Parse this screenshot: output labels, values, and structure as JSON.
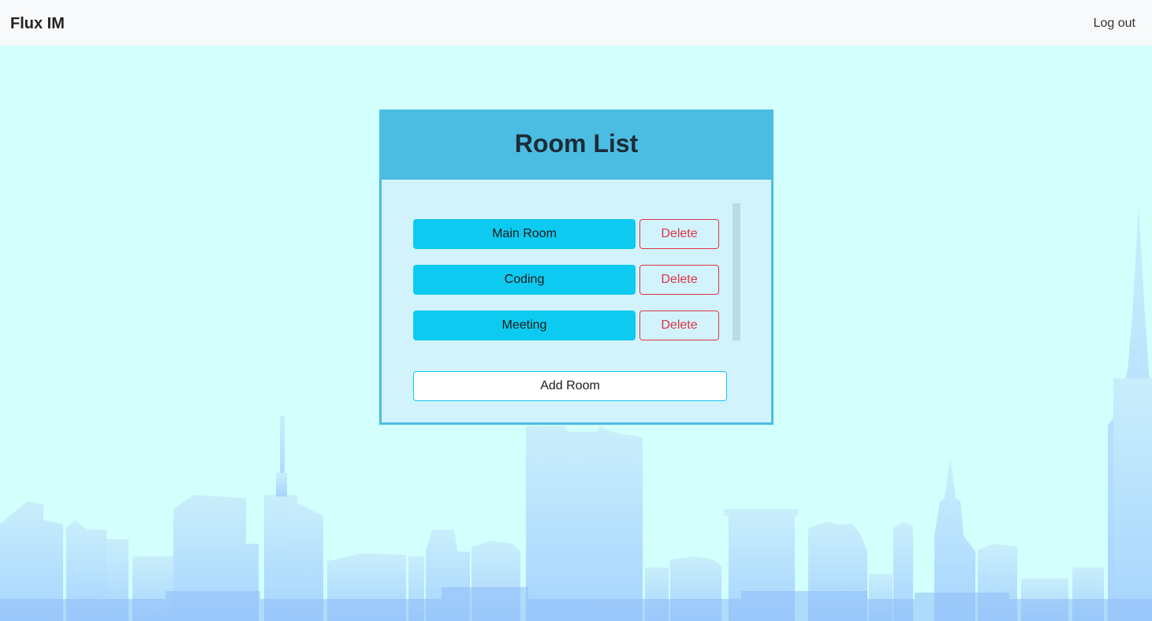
{
  "navbar": {
    "brand": "Flux IM",
    "logout_label": "Log out"
  },
  "card": {
    "title": "Room List",
    "rooms": [
      {
        "name": "Main Room",
        "delete_label": "Delete"
      },
      {
        "name": "Coding",
        "delete_label": "Delete"
      },
      {
        "name": "Meeting",
        "delete_label": "Delete"
      }
    ],
    "add_label": "Add Room"
  },
  "colors": {
    "background": "#d3fffd",
    "header": "#4cbde2",
    "room_button": "#0dcaf0",
    "delete": "#dc3545"
  },
  "background_image": "city-skyline-silhouette"
}
